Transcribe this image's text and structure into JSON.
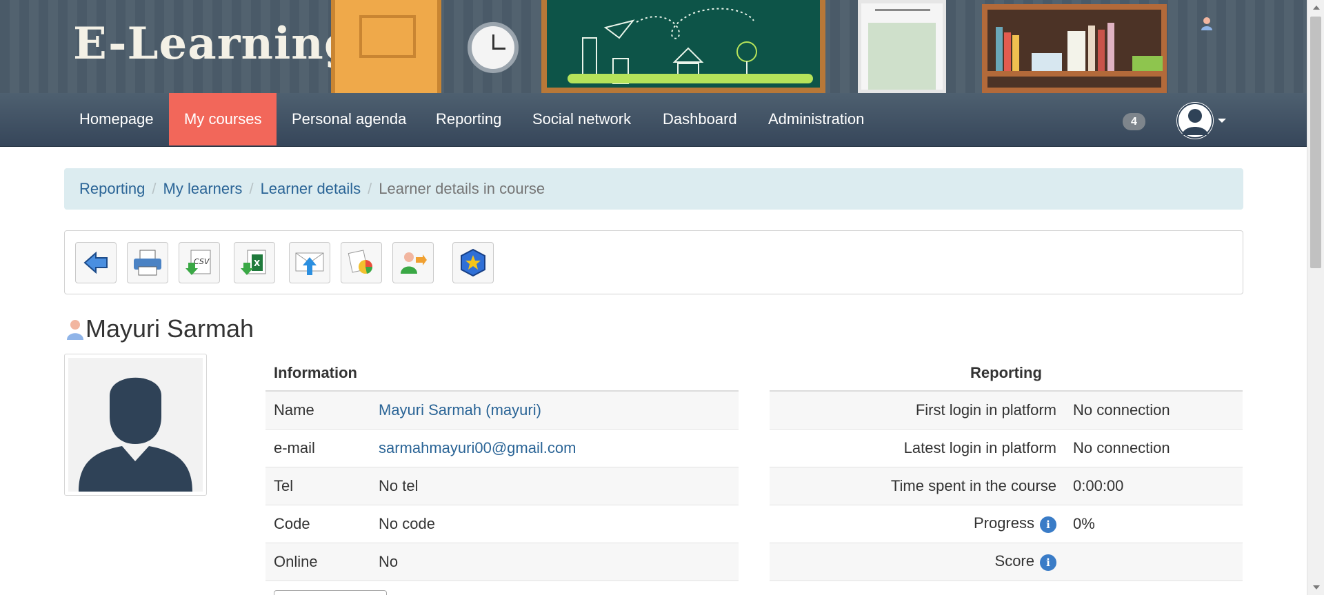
{
  "app": {
    "logo_text": "E-Learning"
  },
  "nav": {
    "items": [
      {
        "label": "Homepage"
      },
      {
        "label": "My courses",
        "active": true
      },
      {
        "label": "Personal agenda"
      },
      {
        "label": "Reporting"
      },
      {
        "label": "Social network"
      },
      {
        "label": "Dashboard"
      },
      {
        "label": "Administration"
      }
    ],
    "notification_count": "4",
    "active_color": "#f2675a"
  },
  "breadcrumb": {
    "items": [
      "Reporting",
      "My learners",
      "Learner details"
    ],
    "current": "Learner details in course",
    "separator": "/"
  },
  "toolbar": {
    "icons": [
      "back-icon",
      "print-icon",
      "csv-export-icon",
      "excel-export-icon",
      "email-upload-icon",
      "report-chart-icon",
      "user-move-icon",
      "badge-star-icon"
    ]
  },
  "learner": {
    "name": "Mayuri Sarmah"
  },
  "information": {
    "header": "Information",
    "rows": [
      {
        "label": "Name",
        "value": "Mayuri Sarmah (mayuri)",
        "link": true
      },
      {
        "label": "e-mail",
        "value": "sarmahmayuri00@gmail.com",
        "link": true
      },
      {
        "label": "Tel",
        "value": "No tel"
      },
      {
        "label": "Code",
        "value": "No code"
      },
      {
        "label": "Online",
        "value": "No"
      }
    ]
  },
  "reporting": {
    "header": "Reporting",
    "rows": [
      {
        "label": "First login in platform",
        "value": "No connection"
      },
      {
        "label": "Latest login in platform",
        "value": "No connection"
      },
      {
        "label": "Time spent in the course",
        "value": "0:00:00"
      },
      {
        "label": "Progress",
        "value": "0%",
        "info": true
      },
      {
        "label": "Score",
        "value": "",
        "info": true
      }
    ]
  },
  "colors": {
    "link": "#2a6496",
    "navbar": "#3f5062",
    "breadcrumb_bg": "#dcecf0"
  }
}
